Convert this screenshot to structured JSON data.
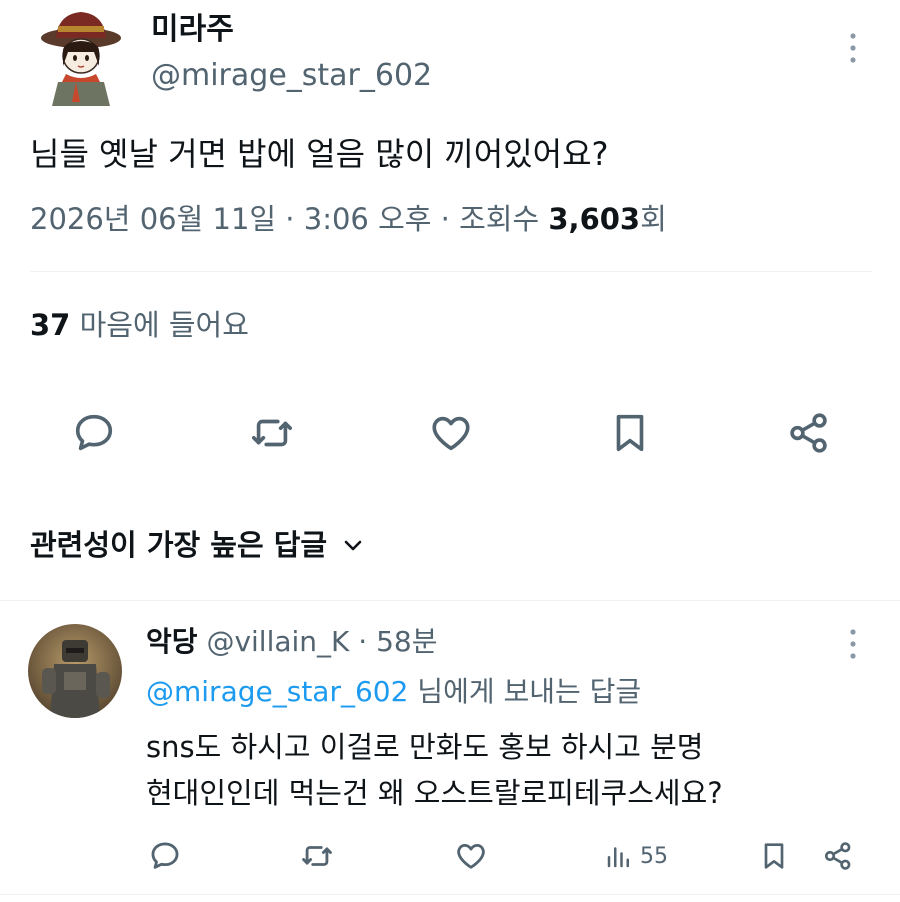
{
  "tweet": {
    "author_name": "미라주",
    "author_handle": "@mirage_star_602",
    "text": "님들 옛날 거면 밥에 얼음 많이 끼어있어요?",
    "date": "2026년 06월 11일",
    "sep1": " · ",
    "time": "3:06 오후",
    "sep2": " · ",
    "views_prefix": "조회수 ",
    "views_count": "3,603",
    "views_suffix": "회",
    "likes_count": "37",
    "likes_label": " 마음에 들어요"
  },
  "actions": {
    "icons": [
      "reply-icon",
      "retweet-icon",
      "like-icon",
      "bookmark-icon",
      "share-icon"
    ]
  },
  "replies_section": {
    "sort_label": "관련성이 가장 높은 답글",
    "sort_icon": "chevron-down-icon"
  },
  "reply": {
    "author_name": "악당",
    "author_handle": "@villain_K",
    "sep": " · ",
    "time": "58분",
    "reply_to_handle": "@mirage_star_602",
    "reply_to_suffix": " 님에게 보내는 답글",
    "text_line1": "sns도 하시고 이걸로 만화도 홍보 하시고 분명",
    "text_line2": "현대인인데 먹는건 왜 오스트랄로피테쿠스세요?",
    "views_count": "55"
  },
  "colors": {
    "text": "#0f1419",
    "muted": "#536471",
    "link": "#1d9bf0",
    "divider": "#eff3f4"
  }
}
